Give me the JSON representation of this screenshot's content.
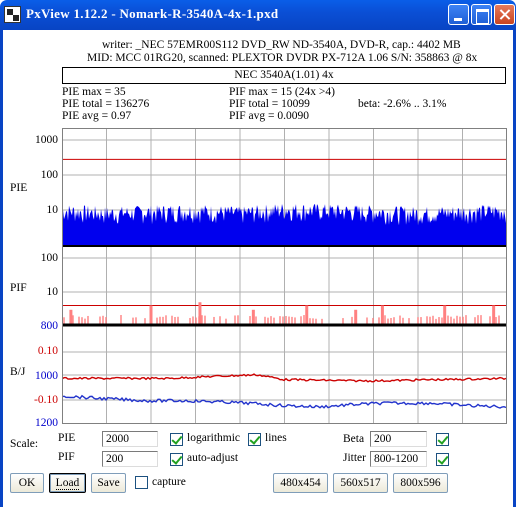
{
  "window": {
    "title": "PxView 1.12.2  -  Nomark-R-3540A-4x-1.pxd"
  },
  "header": {
    "writer": "writer: _NEC 57EMR00S112 DVD_RW ND-3540A, DVD-R, cap.: 4402 MB",
    "mid": "MID: MCC 01RG20, scanned: PLEXTOR DVDR PX-712A 1.06 S/N: 358863 @ 8x",
    "disc_label": "NEC 3540A(1.01) 4x"
  },
  "stats": {
    "pie_max": "PIE max = 35",
    "pie_total": "PIE total = 136276",
    "pie_avg": "PIE avg = 0.97",
    "pif_max": "PIF max = 15 (24x >4)",
    "pif_total": "PIF total = 10099",
    "pif_avg": "PIF avg = 0.0090",
    "beta": "beta: -2.6% .. 3.1%"
  },
  "graph": {
    "pie_label": "PIE",
    "pif_label": "PIF",
    "bj_label": "B/J",
    "pie_ticks": [
      "1000",
      "100",
      "10"
    ],
    "pif_ticks": [
      "100",
      "10"
    ],
    "bj_ticks": [
      "800",
      "0.10",
      "1000",
      "-0.10",
      "1200"
    ],
    "colors": {
      "pie": "#0000ee",
      "pif": "#ff8080",
      "beta": "#cc0000",
      "jitter": "#2233cc",
      "threshold": "#cc0000",
      "grid": "#b0b0b0"
    }
  },
  "chart_data": [
    {
      "type": "area",
      "name": "PIE",
      "yscale": "log",
      "ylim": [
        1,
        1000
      ],
      "y_ticks": [
        10,
        100,
        1000
      ],
      "threshold": 280,
      "x": [
        0,
        10,
        20,
        30,
        40,
        50,
        60,
        70,
        80,
        90,
        100
      ],
      "values": [
        12,
        10,
        11,
        12,
        10,
        13,
        12,
        11,
        10,
        11,
        12
      ]
    },
    {
      "type": "bar",
      "name": "PIF",
      "yscale": "log",
      "ylim": [
        1,
        100
      ],
      "y_ticks": [
        10,
        100
      ],
      "threshold": 4,
      "x": [
        2,
        20,
        31,
        43,
        55,
        66,
        72,
        86,
        97
      ],
      "values": [
        3,
        4,
        5,
        3,
        4,
        3,
        4,
        4,
        4
      ]
    },
    {
      "type": "line",
      "name": "Beta",
      "ylim": [
        -0.2,
        0.2
      ],
      "y_ticks": [
        0.1,
        -0.1
      ],
      "x": [
        0,
        12,
        24,
        36,
        44,
        50,
        66,
        72,
        83,
        86,
        100
      ],
      "values": [
        -0.01,
        -0.01,
        -0.01,
        0.0,
        0.005,
        -0.015,
        -0.02,
        -0.02,
        -0.015,
        -0.015,
        -0.01
      ]
    },
    {
      "type": "line",
      "name": "Jitter",
      "ylim": [
        800,
        1200
      ],
      "y_ticks": [
        800,
        1000,
        1200
      ],
      "x": [
        0,
        8,
        19,
        28,
        36,
        42,
        50,
        58,
        66,
        72,
        83,
        92,
        100
      ],
      "values": [
        1085,
        1095,
        1105,
        1105,
        1110,
        1115,
        1125,
        1130,
        1120,
        1115,
        1115,
        1125,
        1130
      ]
    }
  ],
  "controls": {
    "scale_label": "Scale:",
    "pie_label": "PIE",
    "pie_value": "2000",
    "pif_label": "PIF",
    "pif_value": "200",
    "logarithmic_label": "logarithmic",
    "lines_label": "lines",
    "auto_adjust_label": "auto-adjust",
    "beta_label": "Beta",
    "beta_value": "200",
    "jitter_label": "Jitter",
    "jitter_value": "800-1200",
    "capture_label": "capture",
    "ok_label": "OK",
    "load_label": "Load",
    "save_label": "Save",
    "size1_label": "480x454",
    "size2_label": "560x517",
    "size3_label": "800x596"
  }
}
